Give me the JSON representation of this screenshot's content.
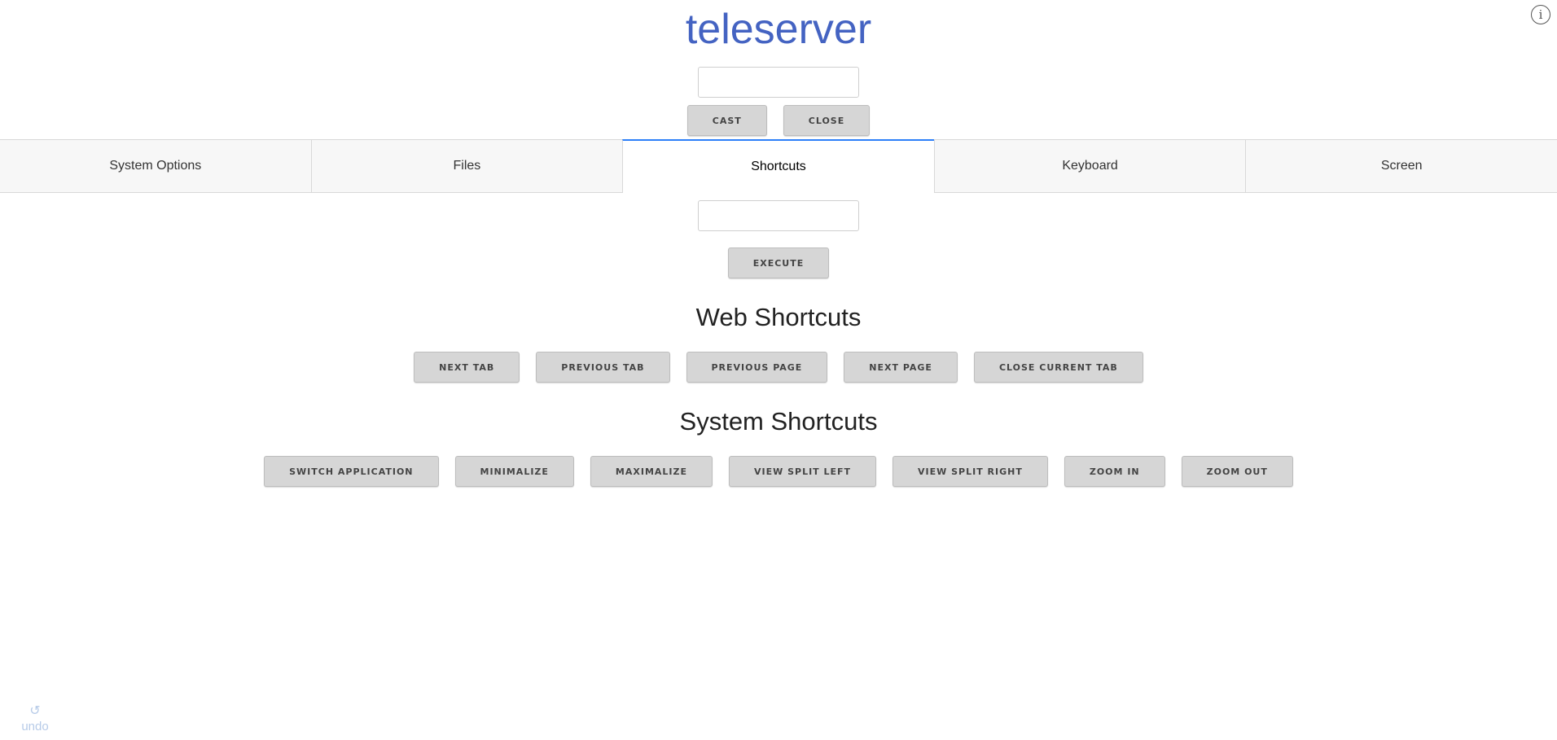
{
  "app": {
    "title": "teleserver"
  },
  "cast_input": {
    "value": "",
    "placeholder": ""
  },
  "cast_buttons": {
    "cast": "Cast",
    "close": "Close"
  },
  "tabs": [
    {
      "label": "System Options",
      "active": false
    },
    {
      "label": "Files",
      "active": false
    },
    {
      "label": "Shortcuts",
      "active": true
    },
    {
      "label": "Keyboard",
      "active": false
    },
    {
      "label": "Screen",
      "active": false
    }
  ],
  "command_input": {
    "value": "",
    "placeholder": ""
  },
  "execute_label": "Execute",
  "web_shortcuts": {
    "title": "Web Shortcuts",
    "buttons": [
      "Next Tab",
      "Previous Tab",
      "Previous Page",
      "Next Page",
      "Close Current Tab"
    ]
  },
  "system_shortcuts": {
    "title": "System Shortcuts",
    "buttons": [
      "Switch Application",
      "Minimalize",
      "Maximalize",
      "View Split Left",
      "View Split Right",
      "Zoom In",
      "Zoom Out"
    ]
  },
  "undo": {
    "label": "undo",
    "icon": "undo-icon"
  },
  "icons": {
    "info": "info-icon"
  },
  "colors": {
    "title": "#4463c2",
    "active_tab_indicator": "#2d7ff9",
    "button_bg": "#d6d6d6",
    "undo": "#b7cbe8"
  }
}
